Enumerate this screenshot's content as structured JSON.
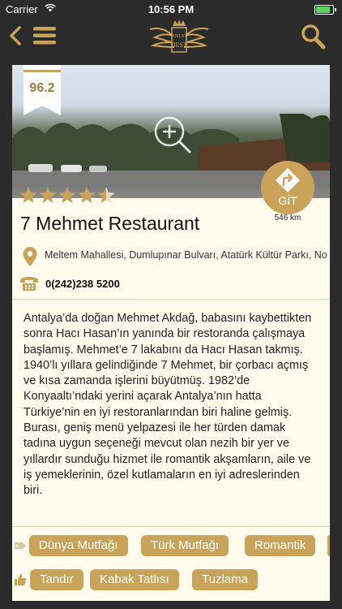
{
  "status": {
    "carrier": "Carrier",
    "time": "10:56 PM"
  },
  "header": {
    "logo_text_1": "ENLYI",
    "logo_text_2": "BEST"
  },
  "restaurant": {
    "score": "96.2",
    "rating_stars": 4.5,
    "name": "7 Mehmet Restaurant",
    "go_label": "GİT",
    "distance": "546 km",
    "address": "Meltem Mahallesi, Dumlupınar Bulvarı, Atatürk Kültür Parkı, No",
    "phone": "0(242)238 5200",
    "description": "Antalya’da doğan Mehmet Akdağ, babasını kaybettikten sonra Hacı Hasan’ın yanında bir restoranda çalışmaya başlamış. Mehmet’e 7 lakabını da Hacı Hasan takmış. 1940’lı yıllara gelindiğinde 7 Mehmet, bir çorbacı açmış ve kısa zamanda işlerini büyütmüş. 1982’de Konyaaltı’ndaki yerini açarak Antalya’nın hatta Türkiye’nin en iyi restoranlarından biri haline gelmiş. Burası, geniş menü yelpazesi ile her türden damak tadına uygun seçeneği mevcut olan nezih bir yer ve yıllardır sunduğu hizmet ile romantik akşamların, aile ve iş yemeklerinin, özel kutlamaların en iyi adreslerinden biri."
  },
  "tags": {
    "categories": [
      "Dünya Mutfağı",
      "Türk Mutfağı",
      "Romantik"
    ],
    "favorites": [
      "Tandır",
      "Kabak Tatlısı",
      "Tuzlama"
    ]
  },
  "colors": {
    "gold": "#c9a35a",
    "card": "#fffcee",
    "bar": "#2b2b2b"
  }
}
